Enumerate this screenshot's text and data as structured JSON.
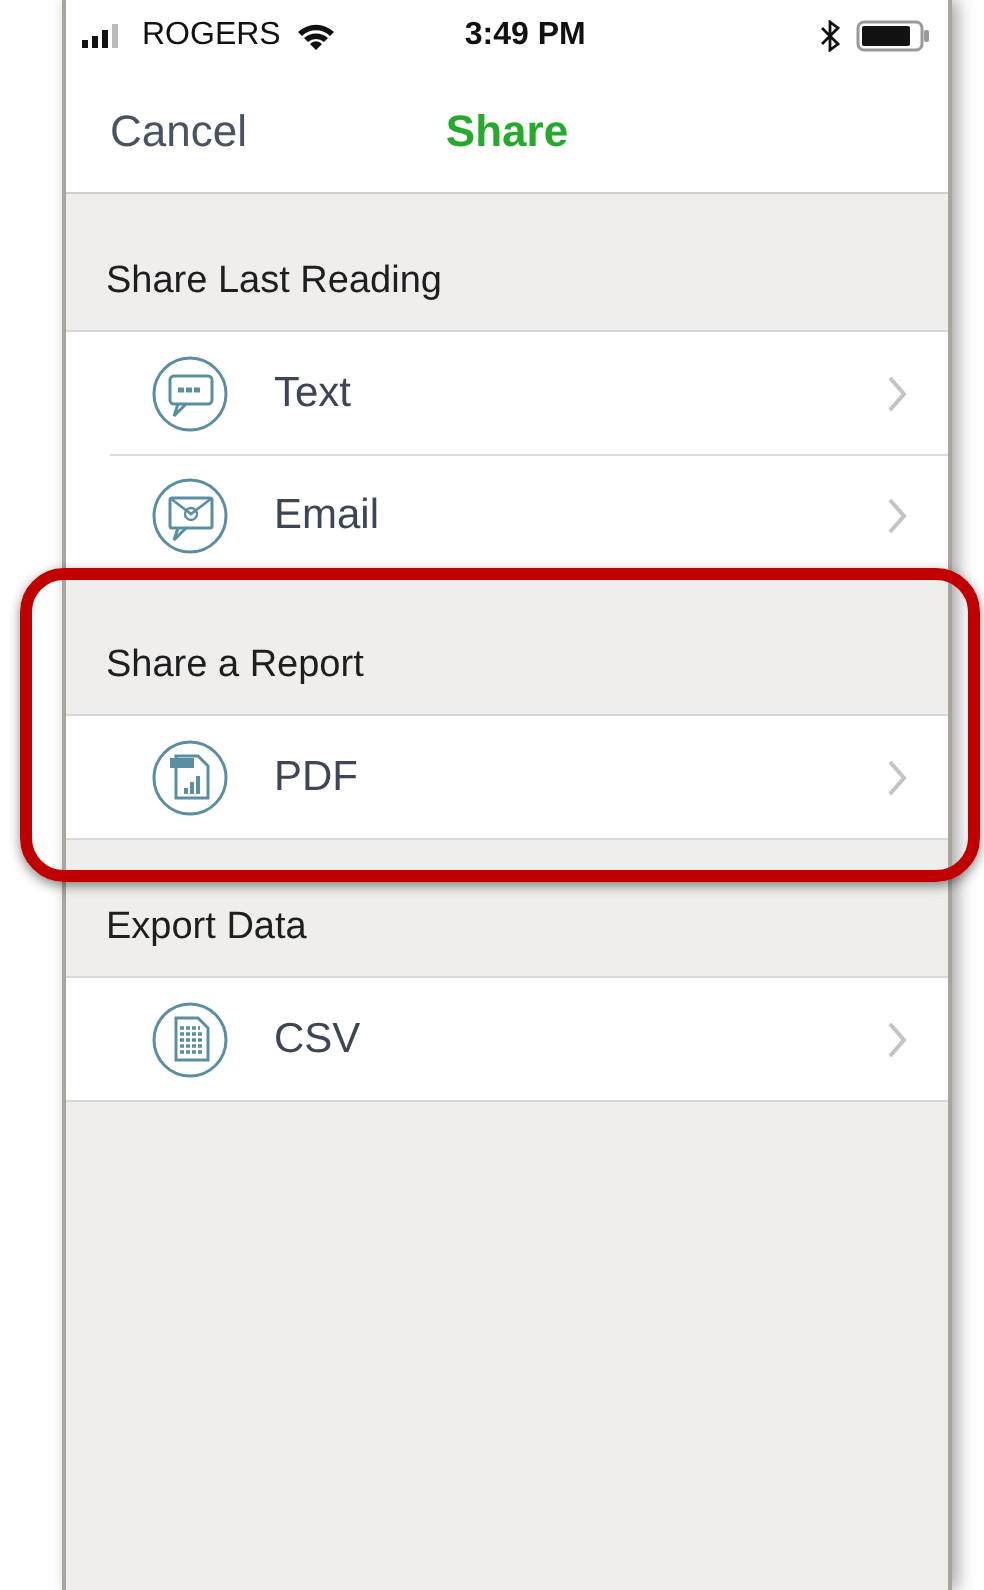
{
  "status_bar": {
    "carrier": "ROGERS",
    "time": "3:49 PM"
  },
  "nav_bar": {
    "cancel": "Cancel",
    "title": "Share"
  },
  "sections": [
    {
      "title": "Share Last Reading",
      "highlighted": false,
      "items": [
        {
          "kind": "sms",
          "label": "Text"
        },
        {
          "kind": "email",
          "label": "Email"
        }
      ]
    },
    {
      "title": "Share a Report",
      "highlighted": true,
      "items": [
        {
          "kind": "pdf",
          "label": "PDF"
        }
      ]
    },
    {
      "title": "Export Data",
      "highlighted": false,
      "items": [
        {
          "kind": "csv",
          "label": "CSV"
        }
      ]
    }
  ]
}
